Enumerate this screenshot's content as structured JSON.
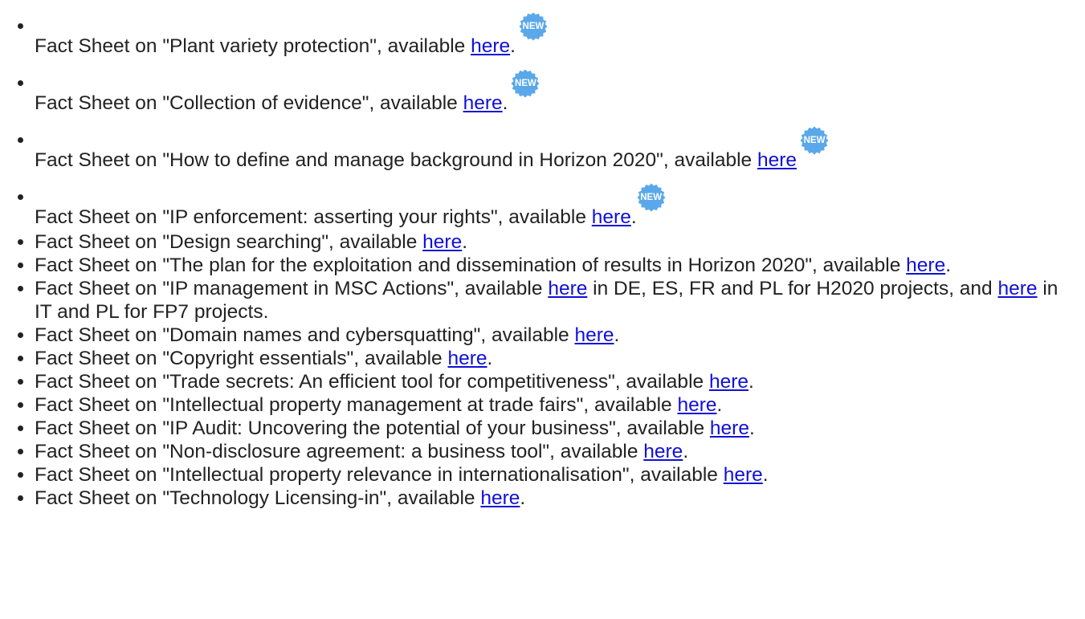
{
  "colors": {
    "text": "#222222",
    "link": "#1010d8",
    "badge": "#5aa8ea"
  },
  "badge_label": "NEW",
  "items": [
    {
      "before": "Fact Sheet on \"Plant variety protection\", available ",
      "link": "here",
      "after": ".",
      "badge": true
    },
    {
      "before": "Fact Sheet on \"Collection of evidence\", available ",
      "link": "here",
      "after": ".",
      "badge": true
    },
    {
      "before": "Fact Sheet on \"How to define and manage background in Horizon 2020\", available ",
      "link": "here",
      "after": "",
      "badge": true
    },
    {
      "before": "Fact Sheet on \"IP enforcement: asserting your rights\", available ",
      "link": "here",
      "after": ".",
      "badge": true
    },
    {
      "before": "Fact Sheet on \"Design searching\", available ",
      "link": "here",
      "after": "."
    },
    {
      "before": "Fact Sheet on \"The plan for the exploitation and dissemination of results in Horizon 2020\", available ",
      "link": "here",
      "after": "."
    },
    {
      "before": "Fact Sheet on \"IP management in MSC Actions\", available ",
      "link": "here",
      "middle": " in DE, ES, FR and PL for H2020 projects, and ",
      "link2": "here",
      "after": " in IT and PL for FP7 projects."
    },
    {
      "before": "Fact Sheet on \"Domain names and cybersquatting\", available ",
      "link": "here",
      "after": "."
    },
    {
      "before": "Fact Sheet on \"Copyright essentials\", available ",
      "link": "here",
      "after": "."
    },
    {
      "before": "Fact Sheet on \"Trade secrets: An efficient tool for competitiveness\", available ",
      "link": "here",
      "after": "."
    },
    {
      "before": "Fact Sheet on \"Intellectual property management at trade fairs\", available ",
      "link": "here",
      "after": "."
    },
    {
      "before": "Fact Sheet on \"IP Audit: Uncovering the potential of your business\", available ",
      "link": "here",
      "after": "."
    },
    {
      "before": "Fact Sheet on \"Non-disclosure agreement: a business tool\", available ",
      "link": "here",
      "after": "."
    },
    {
      "before": "Fact Sheet on \"Intellectual property relevance in internationalisation\", available ",
      "link": "here",
      "after": "."
    },
    {
      "before": "Fact Sheet on \"Technology Licensing-in\", available ",
      "link": "here",
      "after": "."
    }
  ]
}
